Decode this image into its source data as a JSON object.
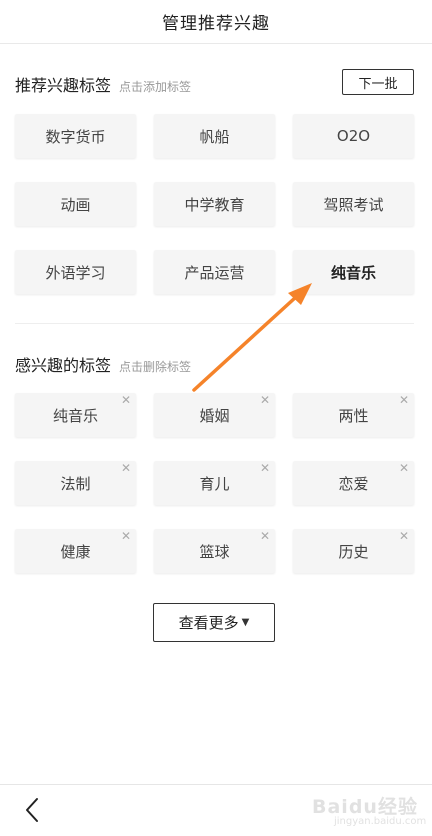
{
  "header": {
    "title": "管理推荐兴趣"
  },
  "recommended": {
    "title": "推荐兴趣标签",
    "hint": "点击添加标签",
    "refresh_label": "下一批",
    "tags": [
      "数字货币",
      "帆船",
      "O2O",
      "动画",
      "中学教育",
      "驾照考试",
      "外语学习",
      "产品运营",
      "纯音乐"
    ]
  },
  "interested": {
    "title": "感兴趣的标签",
    "hint": "点击删除标签",
    "tags": [
      "纯音乐",
      "婚姻",
      "两性",
      "法制",
      "育儿",
      "恋爱",
      "健康",
      "篮球",
      "历史"
    ]
  },
  "more_button": {
    "label": "查看更多"
  },
  "footer": {
    "back_icon": "chevron-left-icon"
  },
  "annotation": {
    "arrow_color": "#f5832a"
  },
  "watermark": {
    "text": "Baidu经验",
    "url": "jingyan.baidu.com"
  }
}
